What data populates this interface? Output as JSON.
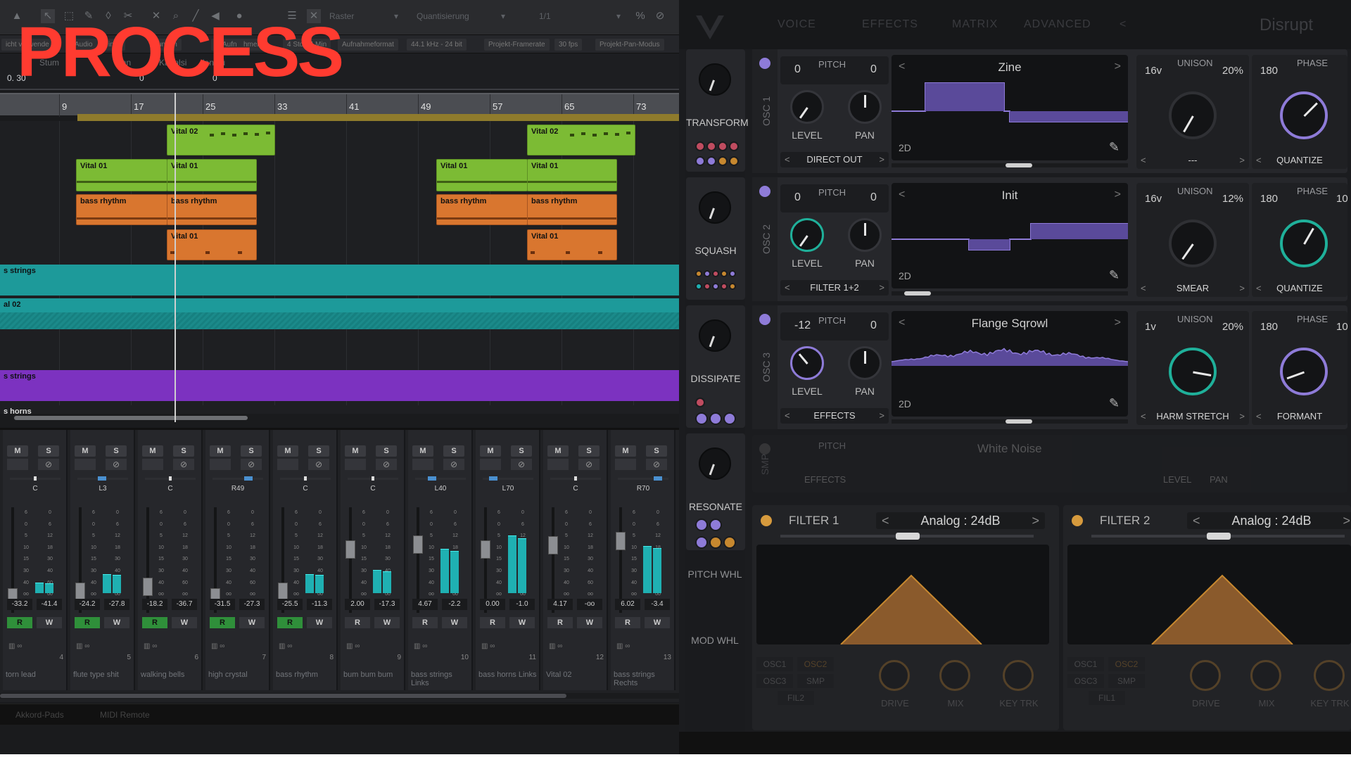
{
  "overlay_title": "PROCESS",
  "daw": {
    "toolbar": {
      "raster_label": "Raster",
      "quantize_label": "Quantisierung",
      "quantize_value": "1/1"
    },
    "infobar": [
      "icht verwende",
      "Audio",
      "ings",
      "unden",
      "s. Aufn",
      "hmen",
      "4 Std 24 Min",
      "Aufnahmeformat",
      "44.1 kHz - 24 bit",
      "Projekt-Framerate",
      "30 fps",
      "Projekt-Pan-Modus"
    ],
    "position": {
      "val1": "0. 30",
      "val2": "0",
      "val3": "0"
    },
    "info_fragments": [
      "Stum",
      "Tran",
      "Kanalsi",
      "lanstü"
    ],
    "ruler_bars": [
      "9",
      "17",
      "25",
      "33",
      "41",
      "49",
      "57",
      "65",
      "73"
    ],
    "clips": {
      "vital02_a": "Vital 02",
      "vital02_b": "Vital 02",
      "vital01_a": "Vital 01",
      "vital01_b": "Vital 01",
      "vital01_c": "Vital 01",
      "vital01_d": "Vital 01",
      "bass_a": "bass rhythm",
      "bass_b": "bass rhythm",
      "bass_c": "bass rhythm",
      "bass_d": "bass rhythm",
      "vital01_e": "Vital 01",
      "vital01_f": "Vital 01"
    },
    "lanes": {
      "teal1": "s strings",
      "teal2": "al 02",
      "purple": "s strings",
      "horns": "s horns"
    },
    "mixer": {
      "mute": "M",
      "solo": "S",
      "read": "R",
      "write": "W",
      "strips": [
        {
          "pan": "C",
          "vol": "-33.2",
          "peak": "-41.4",
          "num": "4",
          "name": "torn lead",
          "fader": 0.15,
          "meter": 0.1,
          "rec": true
        },
        {
          "pan": "L3",
          "vol": "-24.2",
          "peak": "-27.8",
          "num": "5",
          "name": "flute type shit",
          "fader": 0.2,
          "meter": 0.18,
          "rec": true
        },
        {
          "pan": "C",
          "vol": "-18.2",
          "peak": "-36.7",
          "num": "6",
          "name": "walking bells",
          "fader": 0.25,
          "meter": 0.0,
          "rec": true
        },
        {
          "pan": "R49",
          "vol": "-31.5",
          "peak": "-27.3",
          "num": "7",
          "name": "high crystal",
          "fader": 0.15,
          "meter": 0.0,
          "rec": true
        },
        {
          "pan": "C",
          "vol": "-25.5",
          "peak": "-11.3",
          "num": "8",
          "name": "bass rhythm",
          "fader": 0.2,
          "meter": 0.18,
          "rec": true
        },
        {
          "pan": "C",
          "vol": "2.00",
          "peak": "-17.3",
          "num": "9",
          "name": "bum bum bum",
          "fader": 0.6,
          "meter": 0.22,
          "rec": false
        },
        {
          "pan": "L40",
          "vol": "4.67",
          "peak": "-2.2",
          "num": "10",
          "name": "bass strings Links",
          "fader": 0.65,
          "meter": 0.42,
          "rec": false
        },
        {
          "pan": "L70",
          "vol": "0.00",
          "peak": "-1.0",
          "num": "11",
          "name": "bass horns Links",
          "fader": 0.6,
          "meter": 0.55,
          "rec": false
        },
        {
          "pan": "C",
          "vol": "4.17",
          "peak": "-oo",
          "num": "12",
          "name": "Vital 02",
          "fader": 0.64,
          "meter": 0.0,
          "rec": false
        },
        {
          "pan": "R70",
          "vol": "6.02",
          "peak": "-3.4",
          "num": "13",
          "name": "bass strings Rechts",
          "fader": 0.68,
          "meter": 0.45,
          "rec": false
        }
      ]
    },
    "footer": {
      "item1": "Akkord-Pads",
      "item2": "MIDI Remote"
    }
  },
  "vital": {
    "tabs": [
      "VOICE",
      "EFFECTS",
      "MATRIX",
      "ADVANCED"
    ],
    "preset_name": "Disrupt",
    "macros": [
      {
        "label": "TRANSFORM"
      },
      {
        "label": "SQUASH"
      },
      {
        "label": "DISSIPATE"
      },
      {
        "label": "RESONATE"
      }
    ],
    "side_labels": {
      "pitch_wheel": "PITCH WHL",
      "mod_wheel": "MOD WHL"
    },
    "osc_labels": {
      "pitch": "PITCH",
      "level": "LEVEL",
      "pan": "PAN",
      "unison": "UNISON",
      "phase": "PHASE",
      "two_d": "2D"
    },
    "oscillators": [
      {
        "name": "OSC 1",
        "pitch_l": "0",
        "pitch_r": "0",
        "wave": "Zine",
        "dest": "DIRECT OUT",
        "uni_v": "16v",
        "uni_pct": "20%",
        "uni_mode": "---",
        "phase_val": "180",
        "phase_mode": "QUANTIZE"
      },
      {
        "name": "OSC 2",
        "pitch_l": "0",
        "pitch_r": "0",
        "wave": "Init",
        "dest": "FILTER 1+2",
        "uni_v": "16v",
        "uni_pct": "12%",
        "uni_mode": "SMEAR",
        "phase_val": "180",
        "phase_extra": "10",
        "phase_mode": "QUANTIZE"
      },
      {
        "name": "OSC 3",
        "pitch_l": "-12",
        "pitch_r": "0",
        "wave": "Flange Sqrowl",
        "dest": "EFFECTS",
        "uni_v": "1v",
        "uni_pct": "20%",
        "uni_mode": "HARM STRETCH",
        "phase_val": "180",
        "phase_extra": "10",
        "phase_mode": "FORMANT"
      }
    ],
    "smp": {
      "name": "SMP",
      "wave": "White Noise",
      "dest": "EFFECTS",
      "pitch": "PITCH",
      "level": "LEVEL",
      "pan": "PAN"
    },
    "filters": [
      {
        "title": "FILTER 1",
        "type": "Analog : 24dB"
      },
      {
        "title": "FILTER 2",
        "type": "Analog : 24dB"
      }
    ],
    "filter_bottom": {
      "osc1": "OSC1",
      "osc2": "OSC2",
      "osc3": "OSC3",
      "smp": "SMP",
      "fil": "FIL2",
      "fil_b": "FIL1",
      "drive": "DRIVE",
      "mix": "MIX",
      "key": "KEY TRK"
    }
  }
}
